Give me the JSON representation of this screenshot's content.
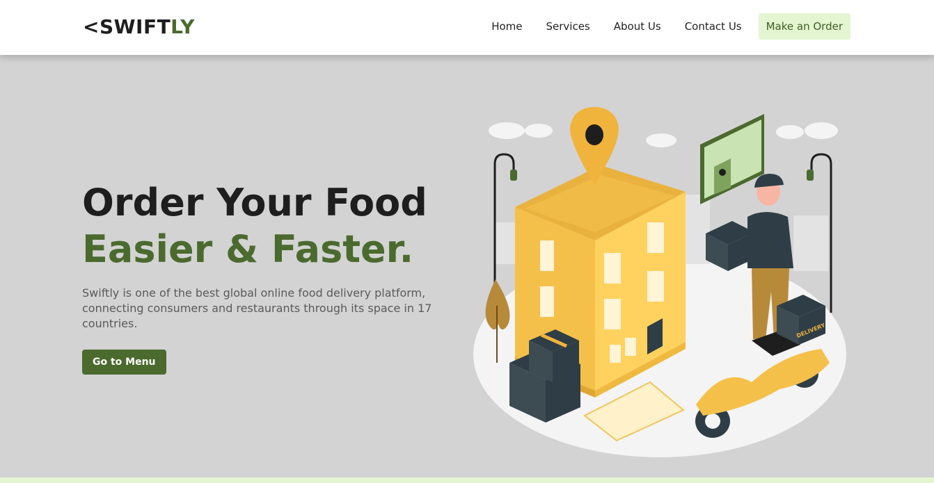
{
  "brand": {
    "prefix": "<",
    "main": "SWIFT",
    "accent": "LY"
  },
  "nav": {
    "links": [
      "Home",
      "Services",
      "About Us",
      "Contact Us"
    ],
    "order_button": "Make an Order"
  },
  "hero": {
    "title_line1": "Order Your Food",
    "title_line2": "Easier & Faster.",
    "description": "Swiftly is one of the best global online food delivery platform, connecting consumers and restaurants through its space in 17 countries.",
    "cta": "Go to Menu"
  },
  "illustration": {
    "box_label": "DELIVERY"
  },
  "colors": {
    "primary": "#4b6a2e",
    "accent_light": "#e4f5d1",
    "background": "#d3d3d3",
    "illustration_yellow": "#f5c04a"
  }
}
